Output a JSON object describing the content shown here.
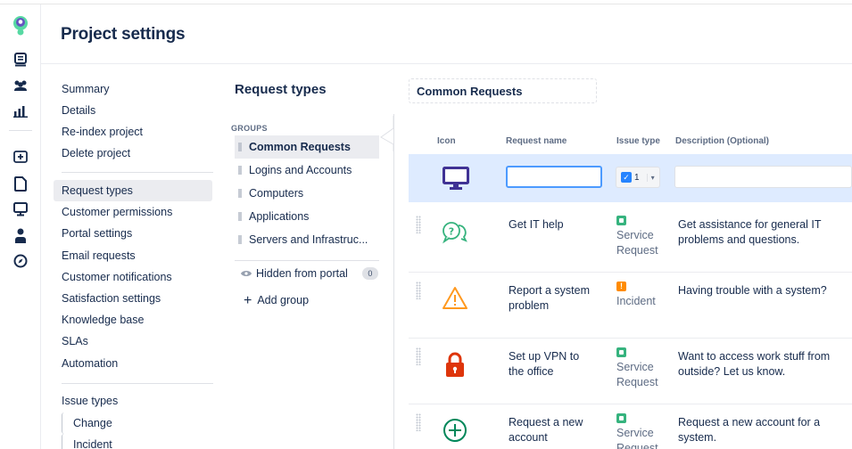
{
  "page": {
    "title": "Project settings"
  },
  "rail_icons": [
    "app-logo-icon",
    "board-icon",
    "team-icon",
    "reports-icon",
    "add-icon",
    "page-icon",
    "monitor-icon",
    "user-icon",
    "compass-icon"
  ],
  "nav": {
    "group1": [
      "Summary",
      "Details",
      "Re-index project",
      "Delete project"
    ],
    "group2": [
      "Request types",
      "Customer permissions",
      "Portal settings",
      "Email requests",
      "Customer notifications",
      "Satisfaction settings",
      "Knowledge base",
      "SLAs",
      "Automation"
    ],
    "active": "Request types",
    "group3_header": "Issue types",
    "group3": [
      "Change",
      "Incident"
    ]
  },
  "request_types": {
    "title": "Request types",
    "groups_label": "GROUPS",
    "groups": [
      "Common Requests",
      "Logins and Accounts",
      "Computers",
      "Applications",
      "Servers and Infrastruc..."
    ],
    "active_group": "Common Requests",
    "hidden_label": "Hidden from portal",
    "hidden_count": "0",
    "add_group": "Add group"
  },
  "panel": {
    "group_name": "Common Requests",
    "columns": {
      "icon": "Icon",
      "name": "Request name",
      "type": "Issue type",
      "desc": "Description (Optional)"
    },
    "new_row": {
      "type_value": "1",
      "name_value": "",
      "desc_value": ""
    },
    "rows": [
      {
        "icon": "speech-bubbles-icon",
        "name": "Get IT help",
        "type": "Service Request",
        "type_color": "#36b37e",
        "desc": "Get assistance for general IT problems and questions."
      },
      {
        "icon": "warning-icon",
        "name": "Report a system problem",
        "type": "Incident",
        "type_color": "#ff8b00",
        "desc": "Having trouble with a system?"
      },
      {
        "icon": "lock-icon",
        "name": "Set up VPN to the office",
        "type": "Service Request",
        "type_color": "#36b37e",
        "desc": "Want to access work stuff from outside? Let us know."
      },
      {
        "icon": "plus-circle-icon",
        "name": "Request a new account",
        "type": "Service Request",
        "type_color": "#36b37e",
        "desc": "Request a new account for a system."
      }
    ]
  },
  "colors": {
    "accent": "#4c9aff",
    "active_bg": "#ebecf0",
    "new_row_bg": "#deebff",
    "service": "#36b37e",
    "incident": "#ff8b00"
  }
}
